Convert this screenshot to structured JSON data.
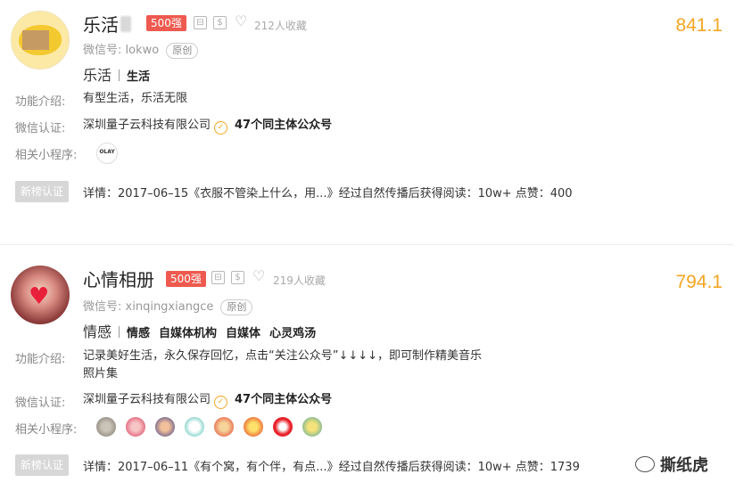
{
  "accounts": [
    {
      "name": "乐活",
      "badge": "500强",
      "favorites": "212人收藏",
      "score": "841.1",
      "wechat_label": "微信号:",
      "wechat_id": "lokwo",
      "original_label": "原创",
      "category": "乐活",
      "tags": [
        "生活"
      ],
      "intro_label": "功能介绍:",
      "intro": "有型生活，乐活无限",
      "cert_label": "微信认证:",
      "cert_company": "深圳量子云科技有限公司",
      "same_entity": "47个同主体公众号",
      "mini_label": "相关小程序:",
      "mini_apps": [
        "OLAY"
      ],
      "new_badge": "新榜认证",
      "detail": "详情：2017–06–15《衣服不管染上什么，用...》经过自然传播后获得阅读：10w+ 点赞：400"
    },
    {
      "name": "心情相册",
      "badge": "500强",
      "favorites": "219人收藏",
      "score": "794.1",
      "wechat_label": "微信号:",
      "wechat_id": "xinqingxiangce",
      "original_label": "原创",
      "category": "情感",
      "tags": [
        "情感",
        "自媒体机构",
        "自媒体",
        "心灵鸡汤"
      ],
      "intro_label": "功能介绍:",
      "intro_line1": "记录美好生活，永久保存回忆，点击“关注公众号”↓↓↓↓，即可制作精美音乐",
      "intro_line2": "照片集",
      "cert_label": "微信认证:",
      "cert_company": "深圳量子云科技有限公司",
      "same_entity": "47个同主体公众号",
      "mini_label": "相关小程序:",
      "mini_apps": [
        "mini-app-1",
        "mini-app-2",
        "mini-app-3",
        "mini-app-4",
        "mini-app-5",
        "mini-app-6",
        "mini-app-7",
        "mini-app-8"
      ],
      "new_badge": "新榜认证",
      "detail": "详情：2017–06–11《有个窝，有个伴，有点...》经过自然传播后获得阅读：10w+ 点赞：1739"
    }
  ],
  "watermark": "撕纸虎",
  "colors": {
    "score": "#f5a623",
    "badge": "#ee5a4f",
    "new_badge": "#d7d7d7"
  }
}
